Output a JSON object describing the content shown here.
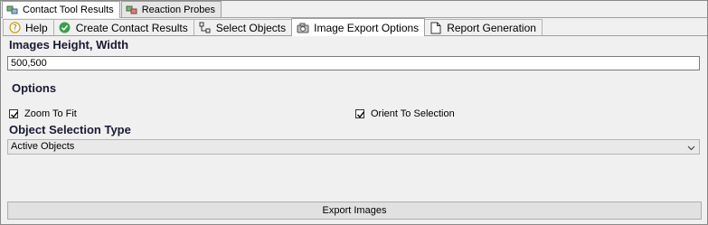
{
  "top_tabs": [
    {
      "label": "Contact Tool Results",
      "icon": "contact-tool-icon",
      "active": true
    },
    {
      "label": "Reaction Probes",
      "icon": "reaction-probe-icon",
      "active": false
    }
  ],
  "tabs": [
    {
      "label": "Help",
      "icon": "help-icon",
      "active": false
    },
    {
      "label": "Create Contact Results",
      "icon": "check-circle-icon",
      "active": false
    },
    {
      "label": "Select Objects",
      "icon": "select-objects-icon",
      "active": false
    },
    {
      "label": "Image Export Options",
      "icon": "camera-icon",
      "active": true
    },
    {
      "label": "Report Generation",
      "icon": "document-icon",
      "active": false
    }
  ],
  "images": {
    "section_title": "Images Height, Width",
    "value": "500,500"
  },
  "options": {
    "section_title": "Options",
    "zoom_to_fit": {
      "label": "Zoom To Fit",
      "checked": true
    },
    "orient_to_selection": {
      "label": "Orient To Selection",
      "checked": true
    }
  },
  "object_selection": {
    "section_title": "Object Selection Type",
    "selected": "Active Objects"
  },
  "export_button": {
    "label": "Export Images"
  },
  "colors": {
    "help_icon": "#c8a000",
    "check_icon": "#3aa04a",
    "accent": "#1a1a33"
  }
}
